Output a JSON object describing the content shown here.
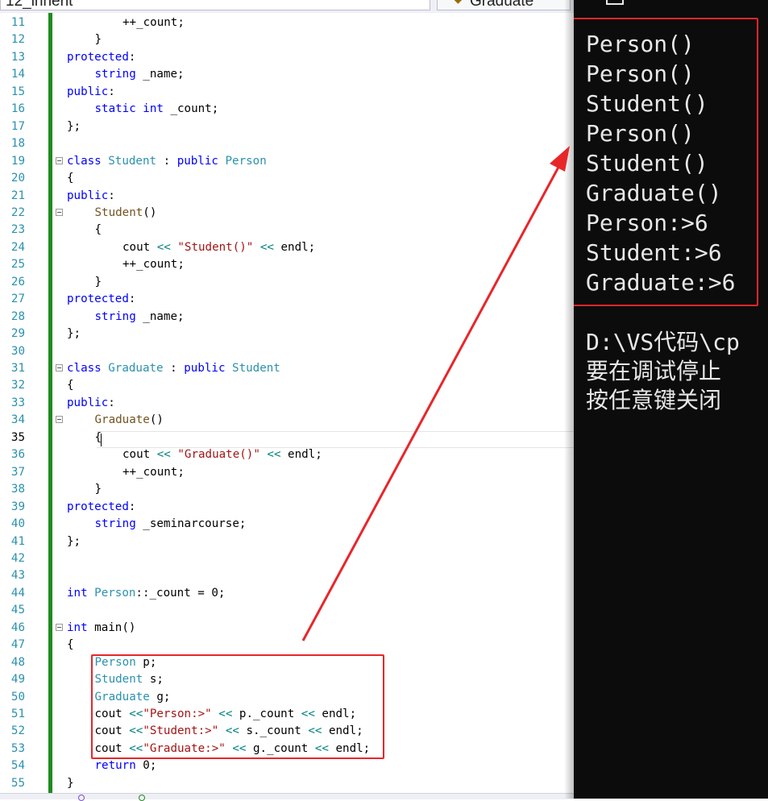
{
  "editor_tabs": [
    {
      "label": "12_inherit"
    },
    {
      "label": "Graduate"
    }
  ],
  "current_line": 35,
  "code_lines": [
    {
      "n": 11,
      "indent": 2,
      "tokens": [
        [
          "++_count;",
          ""
        ]
      ]
    },
    {
      "n": 12,
      "indent": 1,
      "tokens": [
        [
          "}",
          ""
        ]
      ]
    },
    {
      "n": 13,
      "indent": 0,
      "tokens": [
        [
          "protected",
          "kw"
        ],
        [
          ":",
          ""
        ]
      ]
    },
    {
      "n": 14,
      "indent": 1,
      "tokens": [
        [
          "string",
          "kw"
        ],
        [
          " _name;",
          ""
        ]
      ]
    },
    {
      "n": 15,
      "indent": 0,
      "tokens": [
        [
          "public",
          "kw"
        ],
        [
          ":",
          ""
        ]
      ]
    },
    {
      "n": 16,
      "indent": 1,
      "tokens": [
        [
          "static",
          "kw"
        ],
        [
          " ",
          ""
        ],
        [
          "int",
          "kw"
        ],
        [
          " _count;",
          ""
        ]
      ]
    },
    {
      "n": 17,
      "indent": 0,
      "tokens": [
        [
          "};",
          ""
        ]
      ]
    },
    {
      "n": 18,
      "indent": 0,
      "tokens": []
    },
    {
      "n": 19,
      "indent": 0,
      "fold": true,
      "tokens": [
        [
          "class",
          "kw"
        ],
        [
          " ",
          ""
        ],
        [
          "Student",
          "ty"
        ],
        [
          " : ",
          ""
        ],
        [
          "public",
          "kw"
        ],
        [
          " ",
          ""
        ],
        [
          "Person",
          "ty"
        ]
      ]
    },
    {
      "n": 20,
      "indent": 0,
      "tokens": [
        [
          "{",
          ""
        ]
      ]
    },
    {
      "n": 21,
      "indent": 0,
      "tokens": [
        [
          "public",
          "kw"
        ],
        [
          ":",
          ""
        ]
      ]
    },
    {
      "n": 22,
      "indent": 1,
      "fold": true,
      "tokens": [
        [
          "Student",
          "fn"
        ],
        [
          "()",
          ""
        ]
      ]
    },
    {
      "n": 23,
      "indent": 1,
      "tokens": [
        [
          "{",
          ""
        ]
      ]
    },
    {
      "n": 24,
      "indent": 2,
      "tokens": [
        [
          "cout ",
          ""
        ],
        [
          "<<",
          "op"
        ],
        [
          " ",
          ""
        ],
        [
          "\"Student()\"",
          "str"
        ],
        [
          " ",
          ""
        ],
        [
          "<<",
          "op"
        ],
        [
          " endl;",
          ""
        ]
      ]
    },
    {
      "n": 25,
      "indent": 2,
      "tokens": [
        [
          "++_count;",
          ""
        ]
      ]
    },
    {
      "n": 26,
      "indent": 1,
      "tokens": [
        [
          "}",
          ""
        ]
      ]
    },
    {
      "n": 27,
      "indent": 0,
      "tokens": [
        [
          "protected",
          "kw"
        ],
        [
          ":",
          ""
        ]
      ]
    },
    {
      "n": 28,
      "indent": 1,
      "tokens": [
        [
          "string",
          "kw"
        ],
        [
          " _name;",
          ""
        ]
      ]
    },
    {
      "n": 29,
      "indent": 0,
      "tokens": [
        [
          "};",
          ""
        ]
      ]
    },
    {
      "n": 30,
      "indent": 0,
      "tokens": []
    },
    {
      "n": 31,
      "indent": 0,
      "fold": true,
      "tokens": [
        [
          "class",
          "kw"
        ],
        [
          " ",
          ""
        ],
        [
          "Graduate",
          "ty"
        ],
        [
          " : ",
          ""
        ],
        [
          "public",
          "kw"
        ],
        [
          " ",
          ""
        ],
        [
          "Student",
          "ty"
        ]
      ]
    },
    {
      "n": 32,
      "indent": 0,
      "tokens": [
        [
          "{",
          ""
        ]
      ]
    },
    {
      "n": 33,
      "indent": 0,
      "tokens": [
        [
          "public",
          "kw"
        ],
        [
          ":",
          ""
        ]
      ]
    },
    {
      "n": 34,
      "indent": 1,
      "fold": true,
      "tokens": [
        [
          "Graduate",
          "fn"
        ],
        [
          "()",
          ""
        ]
      ]
    },
    {
      "n": 35,
      "indent": 1,
      "tokens": [
        [
          "{",
          ""
        ]
      ]
    },
    {
      "n": 36,
      "indent": 2,
      "tokens": [
        [
          "cout ",
          ""
        ],
        [
          "<<",
          "op"
        ],
        [
          " ",
          ""
        ],
        [
          "\"Graduate()\"",
          "str"
        ],
        [
          " ",
          ""
        ],
        [
          "<<",
          "op"
        ],
        [
          " endl;",
          ""
        ]
      ]
    },
    {
      "n": 37,
      "indent": 2,
      "tokens": [
        [
          "++_count;",
          ""
        ]
      ]
    },
    {
      "n": 38,
      "indent": 1,
      "tokens": [
        [
          "}",
          ""
        ]
      ]
    },
    {
      "n": 39,
      "indent": 0,
      "tokens": [
        [
          "protected",
          "kw"
        ],
        [
          ":",
          ""
        ]
      ]
    },
    {
      "n": 40,
      "indent": 1,
      "tokens": [
        [
          "string",
          "kw"
        ],
        [
          " _seminarcourse;",
          ""
        ]
      ]
    },
    {
      "n": 41,
      "indent": 0,
      "tokens": [
        [
          "};",
          ""
        ]
      ]
    },
    {
      "n": 42,
      "indent": 0,
      "tokens": []
    },
    {
      "n": 43,
      "indent": 0,
      "tokens": []
    },
    {
      "n": 44,
      "indent": 0,
      "tokens": [
        [
          "int",
          "kw"
        ],
        [
          " ",
          ""
        ],
        [
          "Person",
          "ty"
        ],
        [
          "::_count = 0;",
          ""
        ]
      ]
    },
    {
      "n": 45,
      "indent": 0,
      "tokens": []
    },
    {
      "n": 46,
      "indent": 0,
      "fold": true,
      "tokens": [
        [
          "int",
          "kw"
        ],
        [
          " main()",
          ""
        ]
      ]
    },
    {
      "n": 47,
      "indent": 0,
      "tokens": [
        [
          "{",
          ""
        ]
      ]
    },
    {
      "n": 48,
      "indent": 1,
      "tokens": [
        [
          "Person",
          "ty"
        ],
        [
          " p;",
          ""
        ]
      ]
    },
    {
      "n": 49,
      "indent": 1,
      "tokens": [
        [
          "Student",
          "ty"
        ],
        [
          " s;",
          ""
        ]
      ]
    },
    {
      "n": 50,
      "indent": 1,
      "tokens": [
        [
          "Graduate",
          "ty"
        ],
        [
          " g;",
          ""
        ]
      ]
    },
    {
      "n": 51,
      "indent": 1,
      "tokens": [
        [
          "cout ",
          ""
        ],
        [
          "<<",
          "op"
        ],
        [
          "\"Person:>\"",
          "str"
        ],
        [
          " ",
          ""
        ],
        [
          "<<",
          "op"
        ],
        [
          " p._count ",
          ""
        ],
        [
          "<<",
          "op"
        ],
        [
          " endl;",
          ""
        ]
      ]
    },
    {
      "n": 52,
      "indent": 1,
      "tokens": [
        [
          "cout ",
          ""
        ],
        [
          "<<",
          "op"
        ],
        [
          "\"Student:>\"",
          "str"
        ],
        [
          " ",
          ""
        ],
        [
          "<<",
          "op"
        ],
        [
          " s._count ",
          ""
        ],
        [
          "<<",
          "op"
        ],
        [
          " endl;",
          ""
        ]
      ]
    },
    {
      "n": 53,
      "indent": 1,
      "tokens": [
        [
          "cout ",
          ""
        ],
        [
          "<<",
          "op"
        ],
        [
          "\"Graduate:>\"",
          "str"
        ],
        [
          " ",
          ""
        ],
        [
          "<<",
          "op"
        ],
        [
          " g._count ",
          ""
        ],
        [
          "<<",
          "op"
        ],
        [
          " endl;",
          ""
        ]
      ]
    },
    {
      "n": 54,
      "indent": 1,
      "tokens": [
        [
          "return",
          "kw"
        ],
        [
          " 0;",
          ""
        ]
      ]
    },
    {
      "n": 55,
      "indent": 0,
      "tokens": [
        [
          "}",
          ""
        ]
      ]
    }
  ],
  "console": {
    "output_lines": [
      "Person()",
      "Person()",
      "Student()",
      "Person()",
      "Student()",
      "Graduate()",
      "Person:>6",
      "Student:>6",
      "Graduate:>6"
    ],
    "footer_lines": [
      "D:\\VS代码\\cp",
      "要在调试停止",
      "按任意键关闭"
    ]
  },
  "colors": {
    "keyword": "#0000ff",
    "type": "#2b91af",
    "string": "#a31515",
    "function": "#74531f",
    "operator": "#008080",
    "annotation_red": "#e8262a",
    "console_bg": "#0c0c0c",
    "console_fg": "#e8e8e8",
    "change_bar": "#1f8a1f"
  },
  "icons": {
    "tab_class_icon": "class-icon"
  }
}
